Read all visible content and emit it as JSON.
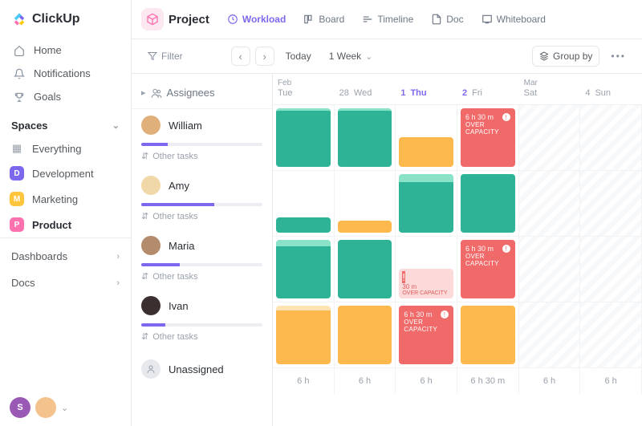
{
  "brand": {
    "name": "ClickUp"
  },
  "sidebar": {
    "nav": [
      {
        "label": "Home"
      },
      {
        "label": "Notifications"
      },
      {
        "label": "Goals"
      }
    ],
    "spaces_header": "Spaces",
    "everything_label": "Everything",
    "spaces": [
      {
        "label": "Development",
        "initial": "D",
        "color": "#7b68ee"
      },
      {
        "label": "Marketing",
        "initial": "M",
        "color": "#ffc53d"
      },
      {
        "label": "Product",
        "initial": "P",
        "color": "#fd71af",
        "active": true
      }
    ],
    "dashboards_label": "Dashboards",
    "docs_label": "Docs",
    "bottom_avatars": [
      {
        "initial": "S",
        "color": "#9b59b6"
      },
      {
        "initial": "",
        "color": "#f4c28c"
      }
    ]
  },
  "header": {
    "project_label": "Project",
    "views": [
      {
        "label": "Workload",
        "active": true
      },
      {
        "label": "Board"
      },
      {
        "label": "Timeline"
      },
      {
        "label": "Doc"
      },
      {
        "label": "Whiteboard"
      }
    ]
  },
  "toolbar": {
    "filter_label": "Filter",
    "today_label": "Today",
    "range_label": "1 Week",
    "groupby_label": "Group by"
  },
  "workload": {
    "assignees_header": "Assignees",
    "other_tasks_label": "Other tasks",
    "unassigned_label": "Unassigned",
    "over_capacity_label": "OVER CAPACITY",
    "columns": [
      {
        "month": "Feb",
        "dow": "Tue",
        "num": ""
      },
      {
        "month": "",
        "dow": "28",
        "num": "Wed"
      },
      {
        "month": "",
        "dow": "1",
        "num": "Thu",
        "today": true
      },
      {
        "month": "",
        "dow": "2",
        "num": "Fri"
      },
      {
        "month": "Mar",
        "dow": "Sat",
        "num": ""
      },
      {
        "month": "",
        "dow": "4",
        "num": "Sun"
      }
    ],
    "header_days": [
      {
        "month": "Feb",
        "dow": "Tue",
        "num": ""
      },
      {
        "month": "",
        "dow": "28",
        "num": "Wed"
      },
      {
        "month": "",
        "dow": "1",
        "num": "Thu",
        "today": true
      },
      {
        "month": "",
        "dow": "2",
        "num": "Fri"
      },
      {
        "month": "Mar",
        "dow": "Sat",
        "num": ""
      },
      {
        "month": "",
        "dow": "4",
        "num": "Sun"
      }
    ],
    "assignees": [
      {
        "name": "William",
        "progress": 22,
        "avatar_color": "#e0b07a"
      },
      {
        "name": "Amy",
        "progress": 60,
        "avatar_color": "#f0d8a8"
      },
      {
        "name": "Maria",
        "progress": 32,
        "avatar_color": "#b38b6d"
      },
      {
        "name": "Ivan",
        "progress": 20,
        "avatar_color": "#3b2f2f"
      }
    ],
    "overcap_times": {
      "six_thirty": "6 h 30 m",
      "thirty": "30 m"
    },
    "footer_hours": [
      "6 h",
      "6 h",
      "6 h",
      "6 h 30 m",
      "6 h",
      "6 h"
    ]
  }
}
